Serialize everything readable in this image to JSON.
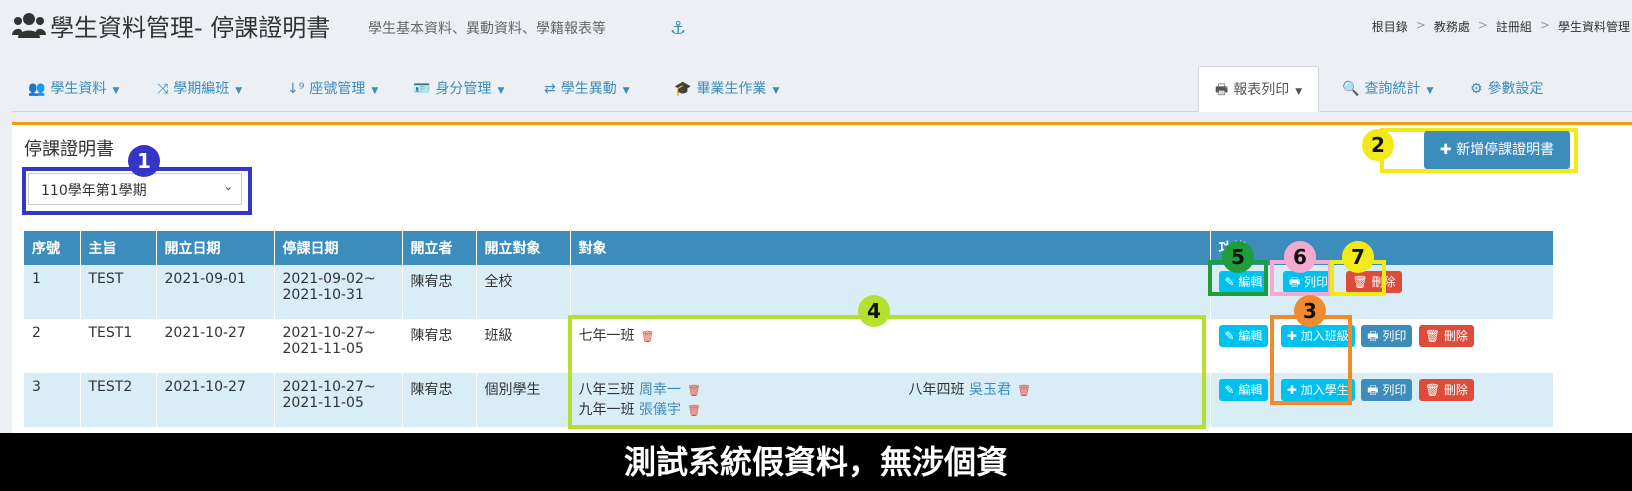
{
  "header": {
    "title": "學生資料管理- 停課證明書",
    "subtitle": "學生基本資料、異動資料、學籍報表等",
    "breadcrumb": [
      "根目錄",
      "教務處",
      "註冊組",
      "學生資料管理"
    ]
  },
  "nav": {
    "items": [
      {
        "label": "學生資料",
        "icon": "users-icon"
      },
      {
        "label": "學期編班",
        "icon": "shuffle-icon"
      },
      {
        "label": "座號管理",
        "icon": "sort-numeric-icon"
      },
      {
        "label": "身分管理",
        "icon": "id-card-icon"
      },
      {
        "label": "學生異動",
        "icon": "exchange-icon"
      },
      {
        "label": "畢業生作業",
        "icon": "graduation-cap-icon"
      },
      {
        "label": "報表列印",
        "icon": "print-icon"
      },
      {
        "label": "查詢統計",
        "icon": "search-icon"
      },
      {
        "label": "參數設定",
        "icon": "gear-icon"
      }
    ]
  },
  "panel": {
    "title": "停課證明書",
    "semester_select": "110學年第1學期",
    "add_button": "新增停課證明書"
  },
  "table": {
    "headers": [
      "序號",
      "主旨",
      "開立日期",
      "停課日期",
      "開立者",
      "開立對象",
      "對象",
      "功能"
    ],
    "rows": [
      {
        "no": "1",
        "subject": "TEST",
        "issue_date": "2021-09-01",
        "stop_from": "2021-09-02~",
        "stop_to": "2021-10-31",
        "issuer": "陳宥忠",
        "target_type": "全校"
      },
      {
        "no": "2",
        "subject": "TEST1",
        "issue_date": "2021-10-27",
        "stop_from": "2021-10-27~",
        "stop_to": "2021-11-05",
        "issuer": "陳宥忠",
        "target_type": "班級",
        "class": "七年一班"
      },
      {
        "no": "3",
        "subject": "TEST2",
        "issue_date": "2021-10-27",
        "stop_from": "2021-10-27~",
        "stop_to": "2021-11-05",
        "issuer": "陳宥忠",
        "target_type": "個別學生",
        "students": [
          {
            "class": "八年三班",
            "name": "周幸一"
          },
          {
            "class": "八年四班",
            "name": "吳玉君"
          },
          {
            "class": "九年一班",
            "name": "張儀宇"
          }
        ]
      }
    ],
    "buttons": {
      "edit": "編輯",
      "print": "列印",
      "delete": "刪除",
      "add_class": "加入班級",
      "add_student": "加入學生"
    }
  },
  "annotations": [
    "1",
    "2",
    "3",
    "4",
    "5",
    "6",
    "7"
  ],
  "footer": "測試系統假資料，無涉個資",
  "colors": {
    "primary": "#3c8dbc",
    "info": "#00c0ef",
    "danger": "#dd4b39",
    "warning_top": "#f39c12",
    "background": "#ecf0f5"
  }
}
